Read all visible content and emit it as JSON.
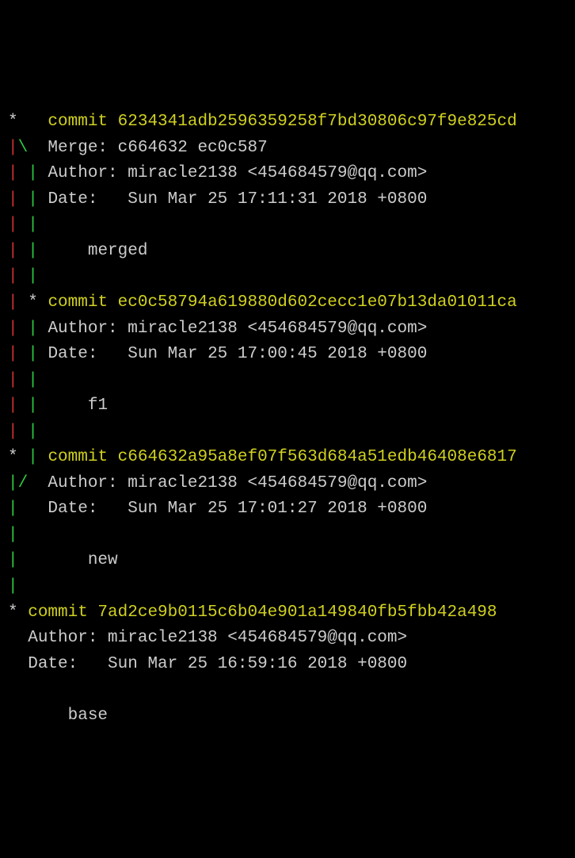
{
  "commits": [
    {
      "graph": [
        {
          "seg": "*   ",
          "cls": "star"
        }
      ],
      "hash_prefix": "commit ",
      "hash": "6234341adb2596359258f7bd30806c97f9e825cd",
      "merge_graph": [
        {
          "seg": "|",
          "cls": "red"
        },
        {
          "seg": "\\  ",
          "cls": "green"
        }
      ],
      "merge": "Merge: c664632 ec0c587",
      "body_graph": [
        {
          "seg": "| ",
          "cls": "red"
        },
        {
          "seg": "| ",
          "cls": "green"
        }
      ],
      "author": "Author: miracle2138 <454684579@qq.com>",
      "date": "Date:   Sun Mar 25 17:11:31 2018 +0800",
      "message": "    merged"
    },
    {
      "graph": [
        {
          "seg": "| ",
          "cls": "red"
        },
        {
          "seg": "* ",
          "cls": "star"
        }
      ],
      "hash_prefix": "commit ",
      "hash": "ec0c58794a619880d602cecc1e07b13da01011ca",
      "body_graph": [
        {
          "seg": "| ",
          "cls": "red"
        },
        {
          "seg": "| ",
          "cls": "green"
        }
      ],
      "author": "Author: miracle2138 <454684579@qq.com>",
      "date": "Date:   Sun Mar 25 17:00:45 2018 +0800",
      "message": "    f1"
    },
    {
      "graph": [
        {
          "seg": "* ",
          "cls": "star"
        },
        {
          "seg": "| ",
          "cls": "green"
        }
      ],
      "hash_prefix": "commit ",
      "hash": "c664632a95a8ef07f563d684a51edb46408e6817",
      "merge_graph": [
        {
          "seg": "|",
          "cls": "green"
        },
        {
          "seg": "/  ",
          "cls": "green"
        }
      ],
      "body_graph": [
        {
          "seg": "|   ",
          "cls": "green"
        }
      ],
      "author": "Author: miracle2138 <454684579@qq.com>",
      "date": "Date:   Sun Mar 25 17:01:27 2018 +0800",
      "message": "    new",
      "post_body_graph_override": true
    },
    {
      "graph": [
        {
          "seg": "* ",
          "cls": "star"
        }
      ],
      "hash_prefix": "commit ",
      "hash": "7ad2ce9b0115c6b04e901a149840fb5fbb42a498",
      "body_graph": [
        {
          "seg": "  ",
          "cls": "star"
        }
      ],
      "author": "Author: miracle2138 <454684579@qq.com>",
      "date": "Date:   Sun Mar 25 16:59:16 2018 +0800",
      "message": "    base"
    }
  ]
}
